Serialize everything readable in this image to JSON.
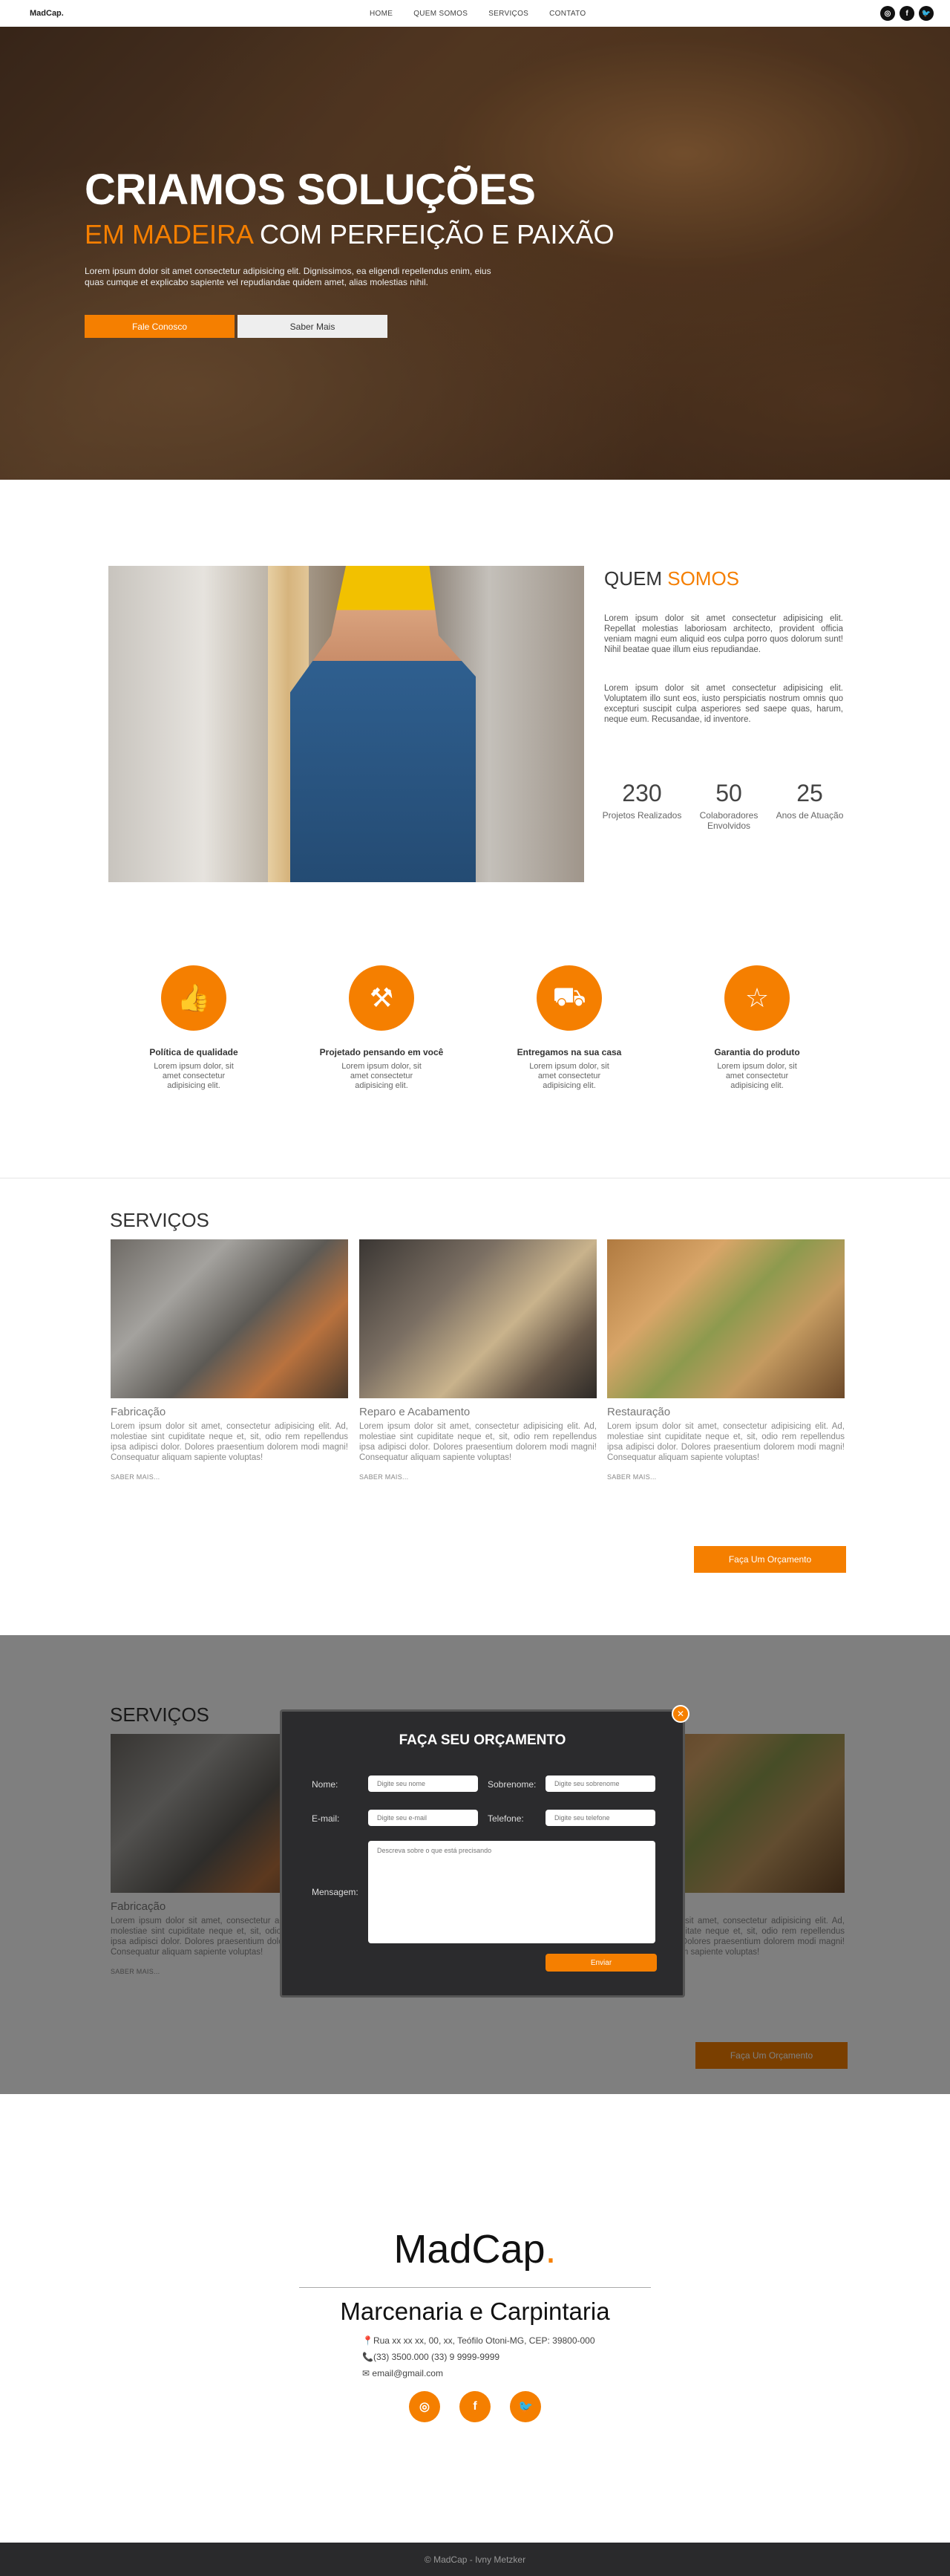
{
  "nav": {
    "logo": "MadCap.",
    "links": [
      "HOME",
      "QUEM SOMOS",
      "SERVIÇOS",
      "CONTATO"
    ],
    "social_icons": [
      "instagram-icon",
      "facebook-icon",
      "twitter-icon"
    ]
  },
  "hero": {
    "title": "CRIAMOS SOLUÇÕES",
    "subtitle_highlight": "EM MADEIRA",
    "subtitle_rest": " COM PERFEIÇÃO E PAIXÃO",
    "text": "Lorem ipsum dolor sit amet consectetur adipisicing elit. Dignissimos, ea eligendi repellendus enim, eius quas cumque et explicabo sapiente vel repudiandae quidem amet, alias molestias nihil.",
    "btn_primary": "Fale Conosco",
    "btn_secondary": "Saber Mais"
  },
  "about": {
    "title_a": "QUEM ",
    "title_b": "SOMOS",
    "p1": "Lorem ipsum dolor sit amet consectetur adipisicing elit. Repellat molestias laboriosam architecto, provident officia veniam magni eum aliquid eos culpa porro quos dolorum sunt! Nihil beatae quae illum eius repudiandae.",
    "p2": "Lorem ipsum dolor sit amet consectetur adipisicing elit. Voluptatem illo sunt eos, iusto perspiciatis nostrum omnis quo excepturi suscipit culpa asperiores sed saepe quas, harum, neque eum. Recusandae, id inventore.",
    "stats": [
      {
        "num": "230",
        "label": "Projetos Realizados"
      },
      {
        "num": "50",
        "label": "Colaboradores Envolvidos"
      },
      {
        "num": "25",
        "label": "Anos de Atuação"
      }
    ]
  },
  "features": [
    {
      "icon": "thumbs-up-icon",
      "title": "Política de qualidade",
      "text": "Lorem ipsum dolor, sit amet consectetur adipisicing elit."
    },
    {
      "icon": "drill-icon",
      "title": "Projetado pensando em você",
      "text": "Lorem ipsum dolor, sit amet consectetur adipisicing elit."
    },
    {
      "icon": "delivery-truck-icon",
      "title": "Entregamos na sua casa",
      "text": "Lorem ipsum dolor, sit amet consectetur adipisicing elit."
    },
    {
      "icon": "star-badge-icon",
      "title": "Garantia do produto",
      "text": "Lorem ipsum dolor, sit amet consectetur adipisicing elit."
    }
  ],
  "services": {
    "title": "SERVIÇOS",
    "cards": [
      {
        "title": "Fabricação",
        "text": "Lorem ipsum dolor sit amet, consectetur adipisicing elit. Ad, molestiae sint cupiditate neque et, sit, odio rem repellendus ipsa adipisci dolor. Dolores praesentium dolorem modi magni! Consequatur aliquam sapiente voluptas!",
        "more": "SABER MAIS..."
      },
      {
        "title": "Reparo e Acabamento",
        "text": "Lorem ipsum dolor sit amet, consectetur adipisicing elit. Ad, molestiae sint cupiditate neque et, sit, odio rem repellendus ipsa adipisci dolor. Dolores praesentium dolorem modi magni! Consequatur aliquam sapiente voluptas!",
        "more": "SABER MAIS..."
      },
      {
        "title": "Restauração",
        "text": "Lorem ipsum dolor sit amet, consectetur adipisicing elit. Ad, molestiae sint cupiditate neque et, sit, odio rem repellendus ipsa adipisci dolor. Dolores praesentium dolorem modi magni! Consequatur aliquam sapiente voluptas!",
        "more": "SABER MAIS..."
      }
    ],
    "quote_btn": "Faça Um Orçamento"
  },
  "modal": {
    "close": "✕",
    "title": "FAÇA SEU ORÇAMENTO",
    "name_label": "Nome:",
    "name_ph": "Digite seu nome",
    "surname_label": "Sobrenome:",
    "surname_ph": "Digite seu sobrenome",
    "email_label": "E-mail:",
    "email_ph": "Digite seu e-mail",
    "phone_label": "Telefone:",
    "phone_ph": "Digite seu telefone",
    "message_label": "Mensagem:",
    "message_ph": "Descreva sobre o que está precisando",
    "send": "Enviar"
  },
  "footer": {
    "logo_a": "MadCap",
    "logo_dot": ".",
    "title": "Marcenaria e Carpintaria",
    "address": "Rua xx xx xx, 00, xx, Teófilo Otoni-MG, CEP: 39800-000",
    "phone": "(33) 3500.000 (33) 9 9999-9999",
    "email": "email@gmail.com",
    "copyright": "© MadCap - Ivny Metzker"
  }
}
